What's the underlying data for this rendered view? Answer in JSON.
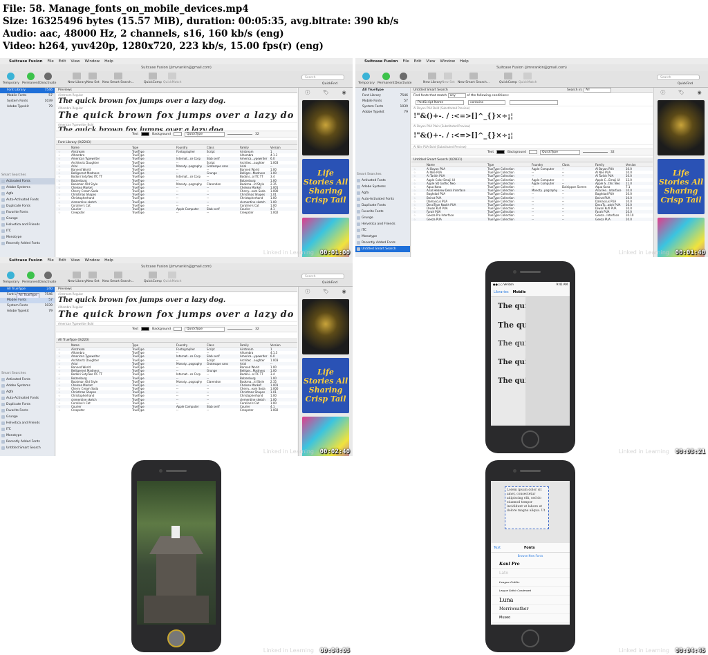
{
  "header": {
    "line1": "File: 58. Manage_fonts_on_mobile_devices.mp4",
    "line2": "Size: 16325496 bytes (15.57 MiB), duration: 00:05:35, avg.bitrate: 390 kb/s",
    "line3": "Audio: aac, 48000 Hz, 2 channels, s16, 160 kb/s (eng)",
    "line4": "Video: h264, yuv420p, 1280x720, 223 kb/s, 15.00 fps(r) (eng)"
  },
  "timestamps": [
    "00:01:00",
    "00:01:40",
    "00:02:40",
    "00:03:21",
    "00:04:05",
    "00:04:45"
  ],
  "watermark": "Linked in Learning",
  "app": {
    "apple": "",
    "name": "Suitcase Fusion",
    "menus": [
      "File",
      "Edit",
      "View",
      "Window",
      "Help"
    ],
    "window_title": "Suitcase Fusion (jimvrankin@gmail.com)",
    "toolbar": {
      "temporary": "Temporary",
      "permanent": "Permanent",
      "deactivate": "Deactivate",
      "new_library": "New Library",
      "new_set": "New Set",
      "new_smart_search": "New Smart Search...",
      "quickcomp": "QuickComp",
      "quickmatch": "QuickMatch",
      "search_placeholder": "Search",
      "quickfind": "QuickFind"
    },
    "libraries": [
      {
        "name": "Font Library",
        "count": "7546"
      },
      {
        "name": "Mobile Fonts",
        "count": "57"
      },
      {
        "name": "System Fonts",
        "count": "1039"
      },
      {
        "name": "Adobe Typekit",
        "count": "79"
      }
    ],
    "smart_head": "Smart Searches",
    "smart_searches": [
      "Activated Fonts",
      "Adobe Systems",
      "Agfa",
      "Auto-Activated Fonts",
      "Duplicate Fonts",
      "Favorite Fonts",
      "Grunge",
      "Helvetica and Friends",
      "ITC",
      "Monotype",
      "Recently Added Fonts"
    ],
    "previews_label": "Previews",
    "preview_items": [
      {
        "label": "Airstream Regular",
        "text": "The quick brown fox jumps over a lazy dog."
      },
      {
        "label": "Alhambra Regular",
        "text": "The quick brown fox jumps over a lazy do"
      },
      {
        "label": "American Typewriter Bold",
        "text": "The quick brown fox jumps over a lazy dog"
      }
    ],
    "pv_ctrl": {
      "text": "Text",
      "background": "Background",
      "quicktype": "QuickType",
      "size": "32"
    },
    "library_head": "Font Library (0/2243)",
    "table_head": [
      "Name",
      "Type",
      "Foundry",
      "Class",
      "Family",
      "Version"
    ],
    "rows": [
      [
        "Airstream",
        "TrueType",
        "Fontographer",
        "Script",
        "Airstream",
        "1"
      ],
      [
        "Alhambra",
        "TrueType",
        "--",
        "--",
        "Alhambra",
        "4.1.3"
      ],
      [
        "American Typewriter",
        "TrueType",
        "Internat...ce Corp",
        "Slab serif",
        "America...ypewriter",
        "6.0"
      ],
      [
        "Architects Daughter",
        "TrueType",
        "--",
        "Script",
        "Architec...aughter",
        "1.003"
      ],
      [
        "Arial",
        "TrueType",
        "Monoty...pography",
        "Grotesque sans",
        "Arial",
        "--"
      ],
      [
        "Banned World",
        "TrueType",
        "--",
        "--",
        "Banned World",
        "1.00"
      ],
      [
        "Belligerent Madness",
        "TrueType",
        "--",
        "Grunge",
        "Belliger...Madness",
        "1.00"
      ],
      [
        "Bodoni SvtyTwo ITC TT",
        "TrueType",
        "Internat...ce Corp",
        "--",
        "Bodoni...o ITC TT",
        "3.4"
      ],
      [
        "Bolzenburg",
        "TrueType",
        "--",
        "--",
        "Bolzenburg",
        "1.00"
      ],
      [
        "Bookman Old Style",
        "TrueType",
        "Monoty...pography",
        "Clarendon",
        "Bookma...ld Style",
        "2.35"
      ],
      [
        "Chelsea Market",
        "TrueType",
        "--",
        "--",
        "Chelsea Market",
        "1.001"
      ],
      [
        "Cherry Cream Soda",
        "TrueType",
        "--",
        "--",
        "Cherry...eam Soda",
        "1.000"
      ],
      [
        "Christmas Shapes",
        "TrueType",
        "--",
        "--",
        "Christmas Shapes",
        "1.01"
      ],
      [
        "Christopherhand",
        "TrueType",
        "--",
        "--",
        "Christopherhand",
        "1.00"
      ],
      [
        "clementine sketch",
        "TrueType",
        "--",
        "--",
        "clementine sketch",
        "1.00"
      ],
      [
        "Coraline's Cat",
        "TrueType",
        "--",
        "--",
        "Coraline's Cat",
        "1.00"
      ],
      [
        "Courier",
        "TrueType",
        "Apple Computer",
        "Slab serif",
        "Courier",
        "4.1"
      ],
      [
        "Creepster",
        "TrueType",
        "--",
        "--",
        "Creepster",
        "1.002"
      ]
    ],
    "right_tabs": [
      "ⓘ",
      "🏷",
      "◉"
    ],
    "cover2_text": "Life Stories All Sharing Crisp Tail",
    "tr": {
      "lib_first": "All TrueType",
      "smart_title": "Untitled Smart Search",
      "search_in": "Search in:",
      "search_in_val": "All",
      "find_prefix": "Find fonts that match",
      "find_any": "any",
      "find_suffix": "of the following conditions:",
      "cond_field": "PostScript Name",
      "cond_op": "contains",
      "previews": [
        {
          "label": "Al Bayan PUA Bold (Substituted Preview)",
          "text": "!\"&()+-. / :<=>[]^_{}×÷¡¦"
        },
        {
          "label": "Al Bayan PUA Plain (Substituted Preview)",
          "text": "!\"&()+-. / :<=>[]^_{}×÷¡¦"
        },
        {
          "label": "Al Nile PUA Bold (Substituted Preview)",
          "text": ""
        }
      ],
      "list_head": "Untitled Smart Search (0/2831)",
      "rows": [
        [
          "Al Bayan PUA",
          "TrueType Collection",
          "Apple Computer",
          "--",
          "Al Bayan PUA",
          "10.0"
        ],
        [
          "Al Nile PUA",
          "TrueType Collection",
          "--",
          "--",
          "Al Nile PUA",
          "10.0"
        ],
        [
          "Al Tarikh PUA",
          "TrueType Collection",
          "--",
          "--",
          "Al Tarikh PUA",
          "10.0"
        ],
        [
          "Apple Color Emoji UI",
          "TrueType Collection",
          "Apple Computer",
          "--",
          "Apple C...Emoji UI",
          "12.0"
        ],
        [
          "Apple SD Gothic Neo",
          "TrueType Collection",
          "Apple Computer",
          "--",
          "Apple S...thic Neo",
          "11.0"
        ],
        [
          "Aqua Kana",
          "TrueType Collection",
          "--",
          "Dainippon Screen",
          "Aqua Kana",
          "7.1"
        ],
        [
          "Arial Hebrew Desk Interface",
          "TrueType Collection",
          "Monoty...pography",
          "--",
          "Arial He...Interface",
          "10.0"
        ],
        [
          "Baghdad PUA",
          "TrueType Collection",
          "--",
          "--",
          "Baghdad PUA",
          "10.0"
        ],
        [
          "Beirut PUA",
          "TrueType Collection",
          "--",
          "--",
          "Beirut PUA",
          "10.0"
        ],
        [
          "Damascus PUA",
          "TrueType Collection",
          "--",
          "--",
          "Damascus PUA",
          "10.0"
        ],
        [
          "DecoType Naskh PUA",
          "TrueType Collection",
          "--",
          "--",
          "DecoTy...askh PUA",
          "10.0"
        ],
        [
          "Diwan Kufi PUA",
          "TrueType Collection",
          "--",
          "--",
          "Diwan Kufi PUA",
          "10.0"
        ],
        [
          "Farah PUA",
          "TrueType Collection",
          "--",
          "--",
          "Farah PUA",
          "10.0"
        ],
        [
          "Geeza Pro Interface",
          "TrueType Collection",
          "--",
          "--",
          "Geeza...Interface",
          "10.10"
        ],
        [
          "Geeza PUA",
          "TrueType Collection",
          "--",
          "--",
          "Geeza PUA",
          "10.0"
        ]
      ]
    },
    "bl": {
      "lib_first": {
        "name": "All TrueType",
        "count": "240"
      },
      "drag_label": "All TrueType",
      "list_head": "All TrueType (0/220)"
    }
  },
  "phone1": {
    "status_left": "●●○○ Verizon",
    "status_time": "9:41 AM",
    "back": "Libraries",
    "title": "Mobile",
    "lines": [
      "The quick",
      "The quick",
      "The quick b",
      "The quick b",
      "The quick b"
    ]
  },
  "phone3": {
    "lorem": "Lorem ipsum dolor sit amet, consectetur adipiscing elit, sed do eiusmod tempor incididunt ut labore et dolore magna aliqua. Ut",
    "back": "Text",
    "title": "Fonts",
    "browse": "Browse New Fonts",
    "fonts": [
      "Kaul Pro",
      "Lato",
      "League Gothic",
      "League Gothic Condensed",
      "Luna",
      "Merriweather",
      "Museo"
    ]
  }
}
